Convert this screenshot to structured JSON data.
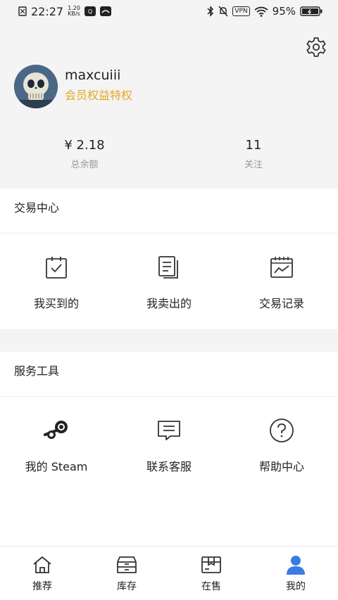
{
  "status_bar": {
    "time": "22:27",
    "net_speed_value": "1.20",
    "net_speed_unit": "KB/s",
    "vpn": "VPN",
    "battery": "95%"
  },
  "profile": {
    "username": "maxcuiii",
    "vip_link": "会员权益特权"
  },
  "stats": {
    "balance_value": "¥ 2.18",
    "balance_label": "总余额",
    "follow_value": "11",
    "follow_label": "关注"
  },
  "trade_center": {
    "title": "交易中心",
    "items": [
      {
        "label": "我买到的",
        "icon": "clipboard-check-icon"
      },
      {
        "label": "我卖出的",
        "icon": "documents-icon"
      },
      {
        "label": "交易记录",
        "icon": "calendar-chart-icon"
      }
    ]
  },
  "service_tools": {
    "title": "服务工具",
    "items": [
      {
        "label": "我的 Steam",
        "icon": "steam-icon"
      },
      {
        "label": "联系客服",
        "icon": "chat-icon"
      },
      {
        "label": "帮助中心",
        "icon": "help-icon"
      }
    ]
  },
  "bottom_nav": {
    "items": [
      {
        "label": "推荐",
        "icon": "home-icon"
      },
      {
        "label": "库存",
        "icon": "inventory-icon"
      },
      {
        "label": "在售",
        "icon": "box-icon"
      },
      {
        "label": "我的",
        "icon": "user-icon"
      }
    ],
    "active_color": "#3b7be3"
  }
}
